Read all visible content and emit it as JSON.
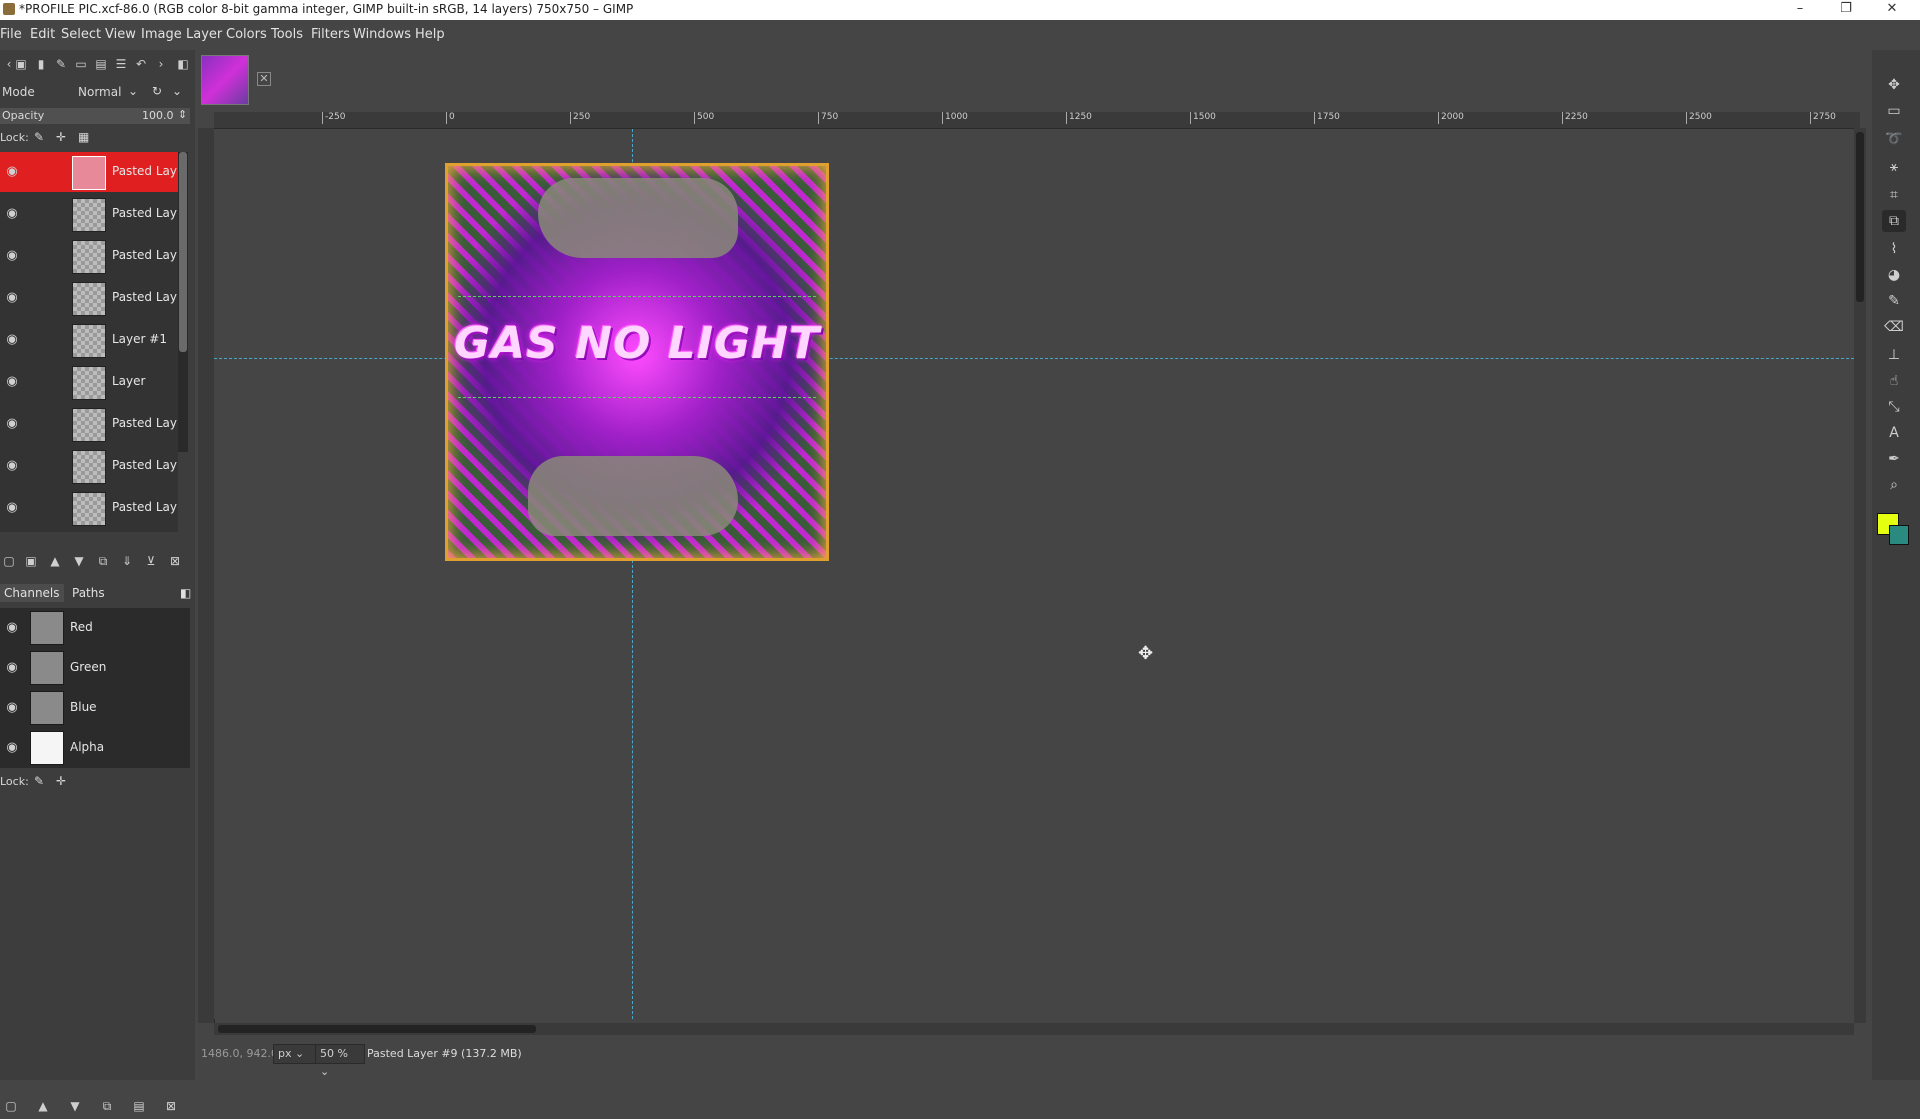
{
  "window": {
    "title": "*PROFILE PIC.xcf-86.0 (RGB color 8-bit gamma integer, GIMP built-in sRGB, 14 layers) 750x750 – GIMP",
    "minimize": "–",
    "maximize": "❐",
    "close": "✕"
  },
  "menu": [
    "File",
    "Edit",
    "Select",
    "View",
    "Image",
    "Layer",
    "Colors",
    "Tools",
    "Filters",
    "Windows",
    "Help"
  ],
  "layers_panel": {
    "mode_label": "Mode",
    "mode_value": "Normal",
    "opacity_label": "Opacity",
    "opacity_value": "100.0",
    "lock_label": "Lock:",
    "layers": [
      {
        "name": "Pasted Lay",
        "selected": true
      },
      {
        "name": "Pasted Lay",
        "selected": false
      },
      {
        "name": "Pasted Lay",
        "selected": false
      },
      {
        "name": "Pasted Lay",
        "selected": false
      },
      {
        "name": "Layer #1",
        "selected": false
      },
      {
        "name": "Layer",
        "selected": false
      },
      {
        "name": "Pasted Lay",
        "selected": false
      },
      {
        "name": "Pasted Lay",
        "selected": false
      },
      {
        "name": "Pasted Lay",
        "selected": false
      }
    ]
  },
  "channels_panel": {
    "tab_channels": "Channels",
    "tab_paths": "Paths",
    "channels": [
      {
        "name": "Red"
      },
      {
        "name": "Green"
      },
      {
        "name": "Blue"
      },
      {
        "name": "Alpha"
      }
    ],
    "lock_label": "Lock:"
  },
  "ruler": {
    "ticks": [
      "-250",
      "0",
      "250",
      "500",
      "750",
      "1000",
      "1250",
      "1500",
      "1750",
      "2000",
      "2250",
      "2500",
      "2750"
    ]
  },
  "artwork": {
    "text": "GAS NO LIGHT"
  },
  "status": {
    "coords": "1486.0, 942.0",
    "unit": "px",
    "zoom": "50 %",
    "message": "Pasted Layer #9 (137.2 MB)"
  },
  "colors": {
    "foreground": "#e4ff10",
    "background": "#2a8a80",
    "selected_layer": "#e02020",
    "guide": "#4aa6c8"
  }
}
